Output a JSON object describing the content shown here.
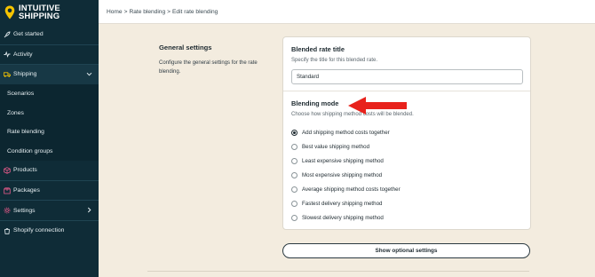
{
  "brand": {
    "line1": "INTUITIVE",
    "line2": "SHIPPING"
  },
  "nav": [
    {
      "label": "Get started",
      "icon": "rocket-icon"
    },
    {
      "label": "Activity",
      "icon": "activity-icon"
    },
    {
      "label": "Shipping",
      "icon": "truck-icon",
      "expanded": true
    },
    {
      "label": "Scenarios",
      "sub": true
    },
    {
      "label": "Zones",
      "sub": true
    },
    {
      "label": "Rate blending",
      "sub": true
    },
    {
      "label": "Condition groups",
      "sub": true
    },
    {
      "label": "Products",
      "icon": "box-icon"
    },
    {
      "label": "Packages",
      "icon": "package-icon"
    },
    {
      "label": "Settings",
      "icon": "gear-icon"
    },
    {
      "label": "Shopify connection",
      "icon": "shopify-icon"
    }
  ],
  "breadcrumb": {
    "home": "Home",
    "sep": ">",
    "rate": "Rate blending",
    "edit": "Edit rate blending"
  },
  "general": {
    "title": "General settings",
    "description": "Configure the general settings for the rate blending."
  },
  "blended": {
    "title": "Blended rate title",
    "help": "Specify the title for this blended rate.",
    "value": "Standard"
  },
  "blending": {
    "title": "Blending mode",
    "help": "Choose how shipping method costs will be blended.",
    "options": [
      {
        "label": "Add shipping method costs together",
        "selected": true
      },
      {
        "label": "Best value shipping method"
      },
      {
        "label": "Least expensive shipping method"
      },
      {
        "label": "Most expensive shipping method"
      },
      {
        "label": "Average shipping method costs together"
      },
      {
        "label": "Fastest delivery shipping method"
      },
      {
        "label": "Slowest delivery shipping method"
      }
    ]
  },
  "optional_button": "Show optional settings",
  "colors": {
    "sidebar": "#0f2c37",
    "logo_accent": "#f5c400",
    "arrow": "#e8221c",
    "background": "#f3ecdf"
  }
}
